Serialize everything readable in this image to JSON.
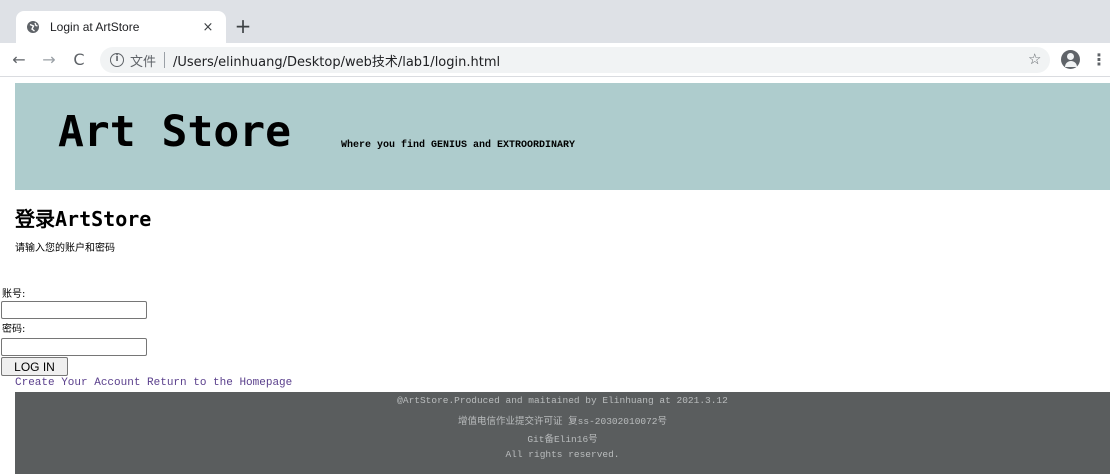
{
  "browser": {
    "tab_title": "Login at ArtStore",
    "tab_close": "×",
    "new_tab": "+",
    "nav": {
      "back": "←",
      "forward": "→",
      "reload": "C"
    },
    "info_glyph": "i",
    "scheme_label": "文件",
    "url": "/Users/elinhuang/Desktop/web技术/lab1/login.html",
    "star": "☆",
    "menu": "⋮"
  },
  "banner": {
    "title": "Art Store",
    "subtitle": "Where you find GENIUS and EXTROORDINARY",
    "background": "#aecccd"
  },
  "main": {
    "title": "登录ArtStore",
    "description": "请输入您的账户和密码",
    "account_label": "账号:",
    "account_value": "",
    "password_label": "密码:",
    "password_value": "",
    "login_button": "LOG IN",
    "links": {
      "create": "Create Your Account",
      "home": "Return to the Homepage"
    },
    "link_color": "#5a3f8c"
  },
  "footer": {
    "lines": [
      "@ArtStore.Produced and maitained by Elinhuang at 2021.3.12",
      "增值电信作业提交许可证 复ss-20302010072号",
      "Git备Elin16号",
      "All rights reserved."
    ],
    "background": "#5a5d5e"
  }
}
